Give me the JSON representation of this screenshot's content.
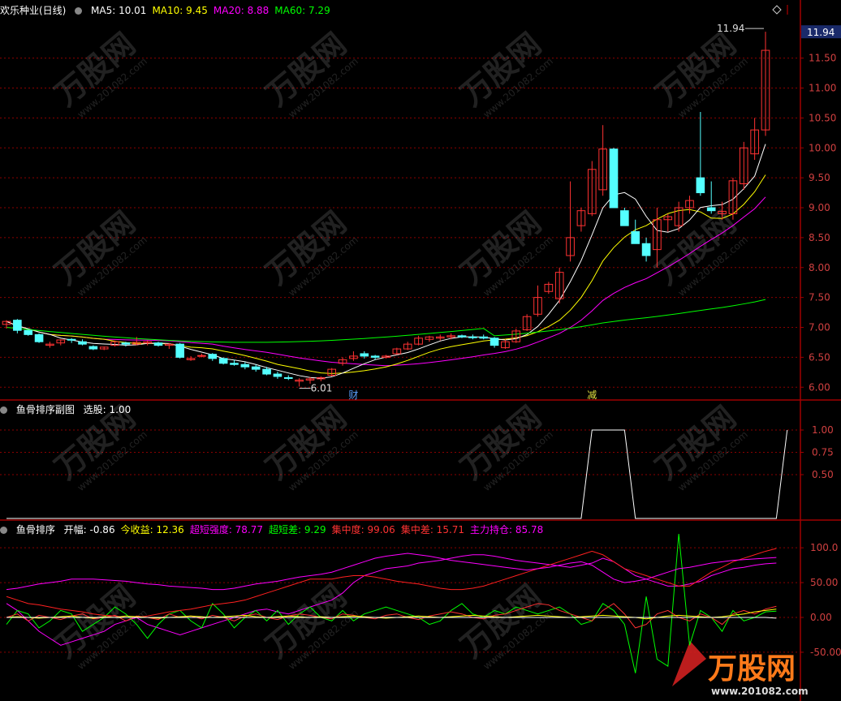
{
  "colors": {
    "up": "#ff3232",
    "down": "#54ffff",
    "ma5": "#ffffff",
    "ma10": "#ffff00",
    "ma20": "#ff00ff",
    "ma60": "#00ff00",
    "grid": "#8b0000",
    "axis": "#a00000"
  },
  "main_header": {
    "stock_name": "欢乐种业(日线)",
    "indicators": [
      {
        "label": "MA5: 10.01",
        "color": "#ffffff"
      },
      {
        "label": "MA10: 9.45",
        "color": "#ffff00"
      },
      {
        "label": "MA20: 8.88",
        "color": "#ff00ff"
      },
      {
        "label": "MA60: 7.29",
        "color": "#00ff00"
      }
    ],
    "current_price_tag": "11.94"
  },
  "sub1_header": {
    "name": "鱼骨排序副图",
    "value": "选股: 1.00"
  },
  "sub2_header": {
    "name": "鱼骨排序",
    "items": [
      {
        "label": "开幅: -0.86",
        "color": "#ffffff"
      },
      {
        "label": "今收益: 12.36",
        "color": "#ffff00"
      },
      {
        "label": "超短强度: 78.77",
        "color": "#ff00ff"
      },
      {
        "label": "超短差: 9.29",
        "color": "#00ff00"
      },
      {
        "label": "集中度: 99.06",
        "color": "#ff3232"
      },
      {
        "label": "集中差: 15.71",
        "color": "#ff3232"
      },
      {
        "label": "主力持仓: 85.78",
        "color": "#ff00ff"
      }
    ]
  },
  "annotations": {
    "high_label": "11.94",
    "low_label": "6.01",
    "event_1": "财",
    "event_2": "减"
  },
  "watermark": {
    "brand": "万股网",
    "url": "www.201082.com"
  },
  "chart_data": [
    {
      "type": "candlestick",
      "title": "欢乐种业(日线)",
      "ylim": [
        5.8,
        12.2
      ],
      "y_ticks": [
        "11.94",
        "11.50",
        "11.00",
        "10.50",
        "10.00",
        "9.50",
        "9.00",
        "8.50",
        "8.00",
        "7.50",
        "7.00",
        "6.50",
        "6.00"
      ],
      "candles": [
        [
          7.05,
          7.12,
          6.98,
          7.1
        ],
        [
          7.12,
          7.14,
          6.9,
          6.95
        ],
        [
          6.95,
          6.96,
          6.86,
          6.88
        ],
        [
          6.88,
          6.9,
          6.74,
          6.76
        ],
        [
          6.7,
          6.76,
          6.66,
          6.72
        ],
        [
          6.74,
          6.8,
          6.7,
          6.79
        ],
        [
          6.8,
          6.82,
          6.74,
          6.79
        ],
        [
          6.76,
          6.8,
          6.7,
          6.72
        ],
        [
          6.68,
          6.7,
          6.62,
          6.64
        ],
        [
          6.64,
          6.68,
          6.62,
          6.67
        ],
        [
          6.7,
          6.78,
          6.68,
          6.76
        ],
        [
          6.74,
          6.76,
          6.68,
          6.72
        ],
        [
          6.72,
          6.84,
          6.7,
          6.75
        ],
        [
          6.74,
          6.78,
          6.7,
          6.76
        ],
        [
          6.74,
          6.76,
          6.68,
          6.7
        ],
        [
          6.7,
          6.74,
          6.64,
          6.72
        ],
        [
          6.72,
          6.74,
          6.48,
          6.5
        ],
        [
          6.46,
          6.52,
          6.44,
          6.48
        ],
        [
          6.52,
          6.56,
          6.5,
          6.53
        ],
        [
          6.55,
          6.57,
          6.44,
          6.48
        ],
        [
          6.48,
          6.5,
          6.38,
          6.4
        ],
        [
          6.4,
          6.46,
          6.36,
          6.38
        ],
        [
          6.38,
          6.42,
          6.3,
          6.34
        ],
        [
          6.34,
          6.38,
          6.26,
          6.3
        ],
        [
          6.3,
          6.34,
          6.2,
          6.22
        ],
        [
          6.22,
          6.26,
          6.14,
          6.18
        ],
        [
          6.16,
          6.2,
          6.12,
          6.15
        ],
        [
          6.1,
          6.15,
          6.01,
          6.12
        ],
        [
          6.12,
          6.17,
          6.06,
          6.14
        ],
        [
          6.14,
          6.18,
          6.1,
          6.16
        ],
        [
          6.2,
          6.32,
          6.18,
          6.3
        ],
        [
          6.4,
          6.5,
          6.36,
          6.46
        ],
        [
          6.48,
          6.6,
          6.44,
          6.52
        ],
        [
          6.56,
          6.6,
          6.48,
          6.52
        ],
        [
          6.52,
          6.54,
          6.46,
          6.5
        ],
        [
          6.5,
          6.54,
          6.48,
          6.52
        ],
        [
          6.56,
          6.66,
          6.54,
          6.64
        ],
        [
          6.64,
          6.76,
          6.62,
          6.72
        ],
        [
          6.72,
          6.86,
          6.7,
          6.82
        ],
        [
          6.8,
          6.86,
          6.76,
          6.84
        ],
        [
          6.82,
          6.88,
          6.78,
          6.84
        ],
        [
          6.84,
          6.9,
          6.8,
          6.86
        ],
        [
          6.86,
          6.88,
          6.82,
          6.84
        ],
        [
          6.84,
          6.88,
          6.8,
          6.83
        ],
        [
          6.84,
          6.88,
          6.8,
          6.82
        ],
        [
          6.82,
          6.84,
          6.66,
          6.7
        ],
        [
          6.66,
          6.8,
          6.64,
          6.76
        ],
        [
          6.76,
          6.98,
          6.74,
          6.94
        ],
        [
          6.96,
          7.22,
          6.94,
          7.18
        ],
        [
          7.22,
          7.7,
          7.18,
          7.5
        ],
        [
          7.6,
          7.76,
          7.56,
          7.72
        ],
        [
          7.48,
          8.0,
          7.4,
          7.92
        ],
        [
          8.2,
          9.44,
          8.1,
          8.5
        ],
        [
          8.7,
          9.0,
          8.6,
          8.95
        ],
        [
          8.9,
          9.78,
          8.86,
          9.64
        ],
        [
          9.3,
          10.38,
          9.2,
          9.98
        ],
        [
          9.98,
          10.0,
          9.0,
          9.0
        ],
        [
          8.95,
          9.0,
          8.7,
          8.7
        ],
        [
          8.6,
          8.8,
          8.4,
          8.4
        ],
        [
          8.4,
          8.5,
          8.1,
          8.2
        ],
        [
          8.3,
          9.0,
          8.0,
          8.8
        ],
        [
          8.8,
          8.9,
          8.6,
          8.85
        ],
        [
          8.7,
          9.1,
          8.6,
          9.0
        ],
        [
          9.0,
          9.2,
          8.9,
          9.12
        ],
        [
          9.5,
          10.6,
          9.2,
          9.25
        ],
        [
          9.0,
          9.44,
          8.9,
          8.95
        ],
        [
          8.9,
          9.1,
          8.8,
          8.94
        ],
        [
          8.9,
          9.5,
          8.8,
          9.45
        ],
        [
          9.4,
          10.1,
          9.3,
          10.0
        ],
        [
          9.9,
          10.5,
          9.8,
          10.3
        ],
        [
          10.3,
          11.94,
          10.2,
          11.63
        ]
      ]
    },
    {
      "type": "line",
      "title": "鱼骨排序副图",
      "ylim": [
        0,
        1.2
      ],
      "y_ticks": [
        "1.00",
        "0.75",
        "0.50"
      ],
      "series": [
        {
          "name": "选股",
          "values": [
            0,
            0,
            0,
            0,
            0,
            0,
            0,
            0,
            0,
            0,
            0,
            0,
            0,
            0,
            0,
            0,
            0,
            0,
            0,
            0,
            0,
            0,
            0,
            0,
            0,
            0,
            0,
            0,
            0,
            0,
            0,
            0,
            0,
            0,
            0,
            0,
            0,
            0,
            0,
            0,
            0,
            0,
            0,
            0,
            0,
            0,
            0,
            0,
            0,
            0,
            0,
            0,
            0,
            0,
            1,
            1,
            1,
            1,
            0,
            0,
            0,
            0,
            0,
            0,
            0,
            0,
            0,
            0,
            0,
            0,
            0,
            0,
            1
          ]
        }
      ]
    },
    {
      "type": "line",
      "title": "鱼骨排序",
      "ylim": [
        -120,
        120
      ],
      "y_ticks": [
        "100.0",
        "50.00",
        "0.00",
        "-50.00"
      ],
      "series": [
        {
          "name": "超短强度",
          "values": [
            20,
            10,
            -5,
            -20,
            -30,
            -40,
            -35,
            -30,
            -25,
            -20,
            -10,
            -5,
            0,
            -10,
            -15,
            -20,
            -25,
            -20,
            -15,
            -10,
            -5,
            0,
            5,
            10,
            12,
            8,
            5,
            10,
            15,
            20,
            25,
            35,
            50,
            60,
            65,
            70,
            72,
            74,
            78,
            80,
            82,
            85,
            88,
            90,
            90,
            88,
            85,
            82,
            80,
            78,
            76,
            74,
            72,
            75,
            78,
            85,
            80,
            70,
            60,
            55,
            50,
            45,
            45,
            48,
            52,
            60,
            65,
            70,
            72,
            75,
            77,
            78
          ]
        },
        {
          "name": "超短差",
          "values": [
            -10,
            10,
            5,
            -15,
            -5,
            10,
            5,
            -20,
            -10,
            0,
            15,
            5,
            -10,
            -30,
            -10,
            5,
            10,
            -5,
            -15,
            20,
            5,
            -15,
            0,
            10,
            -5,
            10,
            -10,
            5,
            15,
            0,
            -5,
            10,
            -5,
            5,
            10,
            15,
            10,
            5,
            0,
            -10,
            -5,
            10,
            20,
            5,
            0,
            10,
            5,
            15,
            10,
            5,
            10,
            15,
            5,
            -10,
            -5,
            20,
            10,
            -10,
            -80,
            30,
            -60,
            -70,
            120,
            -40,
            10,
            0,
            -20,
            10,
            -5,
            0,
            8,
            9
          ]
        },
        {
          "name": "集中度",
          "values": [
            30,
            25,
            20,
            18,
            15,
            12,
            10,
            8,
            5,
            3,
            2,
            0,
            0,
            2,
            5,
            8,
            10,
            12,
            15,
            18,
            20,
            22,
            25,
            30,
            35,
            40,
            45,
            50,
            55,
            55,
            55,
            58,
            60,
            60,
            58,
            55,
            52,
            50,
            48,
            45,
            42,
            40,
            40,
            42,
            45,
            50,
            55,
            60,
            65,
            70,
            75,
            80,
            85,
            90,
            95,
            90,
            80,
            70,
            65,
            60,
            55,
            50,
            45,
            45,
            55,
            65,
            72,
            80,
            85,
            90,
            95,
            99
          ]
        },
        {
          "name": "集中差",
          "values": [
            0,
            5,
            -5,
            3,
            0,
            -3,
            2,
            5,
            -2,
            0,
            3,
            -5,
            2,
            0,
            -3,
            5,
            0,
            2,
            -2,
            3,
            0,
            -5,
            2,
            5,
            0,
            -3,
            2,
            5,
            3,
            0,
            -2,
            5,
            3,
            0,
            -2,
            3,
            5,
            0,
            -3,
            2,
            5,
            8,
            5,
            0,
            -2,
            3,
            5,
            10,
            15,
            20,
            18,
            10,
            5,
            0,
            -5,
            10,
            20,
            5,
            -15,
            -10,
            5,
            10,
            0,
            -5,
            5,
            0,
            -10,
            5,
            10,
            5,
            12,
            16
          ]
        },
        {
          "name": "主力持仓",
          "values": [
            40,
            42,
            45,
            48,
            50,
            52,
            55,
            55,
            55,
            54,
            53,
            52,
            50,
            48,
            47,
            45,
            44,
            43,
            42,
            40,
            40,
            42,
            45,
            48,
            50,
            52,
            55,
            58,
            60,
            62,
            65,
            70,
            75,
            80,
            85,
            88,
            90,
            92,
            90,
            88,
            85,
            82,
            80,
            78,
            76,
            74,
            72,
            70,
            68,
            70,
            72,
            75,
            78,
            80,
            75,
            65,
            55,
            50,
            52,
            55,
            60,
            65,
            70,
            72,
            75,
            78,
            80,
            82,
            83,
            84,
            85,
            86
          ]
        },
        {
          "name": "今收益",
          "values": [
            0,
            1,
            0,
            -1,
            0,
            1,
            2,
            0,
            -1,
            1,
            0,
            2,
            1,
            0,
            -1,
            0,
            1,
            2,
            1,
            0,
            1,
            2,
            3,
            1,
            0,
            1,
            2,
            1,
            0,
            1,
            0,
            1,
            2,
            1,
            0,
            -1,
            0,
            1,
            2,
            1,
            0,
            1,
            2,
            3,
            2,
            1,
            0,
            1,
            2,
            3,
            2,
            1,
            0,
            1,
            2,
            3,
            2,
            1,
            0,
            -2,
            0,
            2,
            3,
            2,
            1,
            0,
            1,
            3,
            5,
            8,
            10,
            12
          ]
        },
        {
          "name": "开幅",
          "values": [
            0,
            0,
            0,
            0,
            0,
            0,
            0,
            0,
            0,
            0,
            0,
            0,
            0,
            0,
            0,
            0,
            0,
            0,
            0,
            0,
            0,
            0,
            0,
            0,
            0,
            0,
            0,
            0,
            0,
            0,
            0,
            0,
            0,
            0,
            0,
            0,
            0,
            0,
            0,
            0,
            0,
            0,
            0,
            0,
            0,
            0,
            0,
            0,
            0,
            0,
            0,
            0,
            0,
            0,
            0,
            0,
            0,
            0,
            0,
            0,
            0,
            0,
            0,
            0,
            0,
            0,
            0,
            0,
            0,
            0,
            0,
            -1
          ]
        }
      ]
    }
  ]
}
